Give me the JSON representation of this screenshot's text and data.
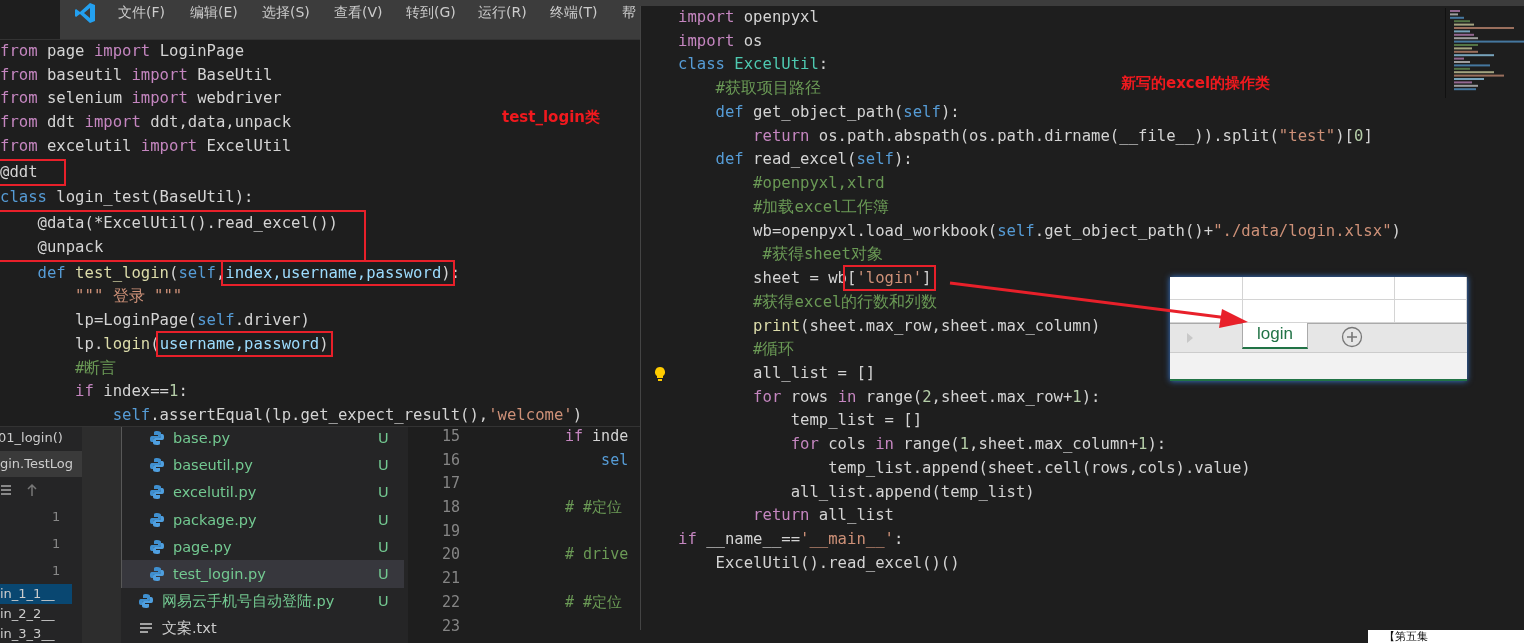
{
  "background_editor": {
    "menu": [
      "文件(F)",
      "编辑(E)",
      "选择(S)",
      "查看(V)",
      "转到(G)",
      "运行(R)",
      "终端(T)",
      "帮"
    ],
    "test_panel": {
      "items": [
        {
          "label": "01_login()",
          "kind": "method"
        },
        {
          "label": "gin.TestLog",
          "kind": "header"
        }
      ],
      "counts": [
        "1",
        "1",
        "1"
      ],
      "runs": [
        {
          "label": "in_1_1__",
          "selected": true
        },
        {
          "label": "in_2_2__",
          "selected": false
        },
        {
          "label": "in_3_3__",
          "selected": false
        }
      ]
    },
    "explorer": {
      "folder_files": [
        {
          "name": "base.py",
          "status": "U",
          "selected": false
        },
        {
          "name": "baseutil.py",
          "status": "U",
          "selected": false
        },
        {
          "name": "excelutil.py",
          "status": "U",
          "selected": false
        },
        {
          "name": "package.py",
          "status": "U",
          "selected": false
        },
        {
          "name": "page.py",
          "status": "U",
          "selected": false
        },
        {
          "name": "test_login.py",
          "status": "U",
          "selected": true
        }
      ],
      "files": [
        {
          "name": "网易云手机号自动登陆.py",
          "kind": "python",
          "status": "U",
          "selected": false
        },
        {
          "name": "文案.txt",
          "kind": "text",
          "selected": false
        }
      ]
    },
    "editor": {
      "lines": [
        {
          "number": "15",
          "tokens": [
            {
              "kind": "keyword",
              "text": "if"
            },
            {
              "kind": "plain",
              "text": " inde"
            }
          ]
        },
        {
          "number": "16",
          "tokens": [
            {
              "kind": "storage",
              "text": "    sel"
            }
          ]
        },
        {
          "number": "17"
        },
        {
          "number": "18",
          "tokens": [
            {
              "kind": "comment",
              "text": "# #定位"
            }
          ]
        },
        {
          "number": "19"
        },
        {
          "number": "20",
          "tokens": [
            {
              "kind": "comment",
              "text": "# drive"
            }
          ]
        },
        {
          "number": "21"
        },
        {
          "number": "22",
          "tokens": [
            {
              "kind": "comment",
              "text": "# #定位"
            }
          ]
        },
        {
          "number": "23"
        }
      ]
    }
  },
  "left_code": {
    "annotation": "test_login类",
    "lines": [
      {
        "tokens": [
          {
            "kind": "keyword",
            "text": "from"
          },
          {
            "kind": "plain",
            "text": " page "
          },
          {
            "kind": "keyword",
            "text": "import"
          },
          {
            "kind": "plain",
            "text": " LoginPage"
          }
        ]
      },
      {
        "tokens": [
          {
            "kind": "keyword",
            "text": "from"
          },
          {
            "kind": "plain",
            "text": " baseutil "
          },
          {
            "kind": "keyword",
            "text": "import"
          },
          {
            "kind": "plain",
            "text": " BaseUtil"
          }
        ]
      },
      {
        "tokens": [
          {
            "kind": "keyword",
            "text": "from"
          },
          {
            "kind": "plain",
            "text": " selenium "
          },
          {
            "kind": "keyword",
            "text": "import"
          },
          {
            "kind": "plain",
            "text": " webdriver"
          }
        ]
      },
      {
        "tokens": [
          {
            "kind": "keyword",
            "text": "from"
          },
          {
            "kind": "plain",
            "text": " ddt "
          },
          {
            "kind": "keyword",
            "text": "import"
          },
          {
            "kind": "plain",
            "text": " ddt,data,unpack"
          }
        ]
      },
      {
        "tokens": [
          {
            "kind": "keyword",
            "text": "from"
          },
          {
            "kind": "plain",
            "text": " excelutil "
          },
          {
            "kind": "keyword",
            "text": "import"
          },
          {
            "kind": "plain",
            "text": " ExcelUtil"
          }
        ]
      },
      {
        "boxed": true,
        "tokens": [
          {
            "kind": "plain",
            "text": "@ddt"
          }
        ]
      },
      {
        "tokens": [
          {
            "kind": "storage",
            "text": "class"
          },
          {
            "kind": "plain",
            "text": " login_test(BaseUtil):"
          }
        ]
      },
      {
        "boxed": true,
        "tokens": [
          {
            "kind": "plain",
            "text": "    @data(*ExcelUtil().read_excel())"
          }
        ]
      },
      {
        "boxed": true,
        "tokens": [
          {
            "kind": "plain",
            "text": "    @unpack"
          }
        ]
      },
      {
        "tokens": [
          {
            "kind": "storage",
            "text": "    def "
          },
          {
            "kind": "function",
            "text": "test_login"
          },
          {
            "kind": "plain",
            "text": "("
          },
          {
            "kind": "storage",
            "text": "self"
          },
          {
            "kind": "plain",
            "text": ","
          },
          {
            "kind": "variable",
            "text": "index,username,password",
            "boxed": true
          },
          {
            "kind": "plain",
            "text": ")",
            "boxed": true
          },
          {
            "kind": "plain",
            "text": ":"
          }
        ]
      },
      {
        "tokens": [
          {
            "kind": "string",
            "text": "        \"\"\" 登录 \"\"\""
          }
        ]
      },
      {
        "tokens": [
          {
            "kind": "plain",
            "text": "        lp=LoginPage("
          },
          {
            "kind": "storage",
            "text": "self"
          },
          {
            "kind": "plain",
            "text": ".driver)"
          }
        ]
      },
      {
        "tokens": [
          {
            "kind": "plain",
            "text": "        lp."
          },
          {
            "kind": "function",
            "text": "login"
          },
          {
            "kind": "plain",
            "text": "("
          },
          {
            "kind": "variable",
            "text": "username,password",
            "boxed": true
          },
          {
            "kind": "plain",
            "text": ")",
            "boxed": true
          }
        ]
      },
      {
        "tokens": [
          {
            "kind": "comment",
            "text": "        #断言"
          }
        ]
      },
      {
        "tokens": [
          {
            "kind": "keyword",
            "text": "        if"
          },
          {
            "kind": "plain",
            "text": " index=="
          },
          {
            "kind": "number",
            "text": "1"
          },
          {
            "kind": "plain",
            "text": ":"
          }
        ]
      },
      {
        "tokens": [
          {
            "kind": "storage",
            "text": "            self"
          },
          {
            "kind": "plain",
            "text": ".assertEqual(lp.get_expect_result(),"
          },
          {
            "kind": "string",
            "text": "'welcome'"
          },
          {
            "kind": "plain",
            "text": ")"
          }
        ]
      }
    ]
  },
  "right_code": {
    "annotation": "新写的excel的操作类",
    "lines": [
      {
        "tokens": [
          {
            "kind": "keyword",
            "text": "import"
          },
          {
            "kind": "plain",
            "text": " openpyxl"
          }
        ]
      },
      {
        "tokens": [
          {
            "kind": "keyword",
            "text": "import"
          },
          {
            "kind": "plain",
            "text": " os"
          }
        ]
      },
      {
        "tokens": [
          {
            "kind": "storage",
            "text": "class "
          },
          {
            "kind": "type",
            "text": "ExcelUtil"
          },
          {
            "kind": "plain",
            "text": ":"
          }
        ]
      },
      {
        "tokens": [
          {
            "kind": "comment",
            "text": "    #获取项目路径"
          }
        ]
      },
      {
        "tokens": [
          {
            "kind": "storage",
            "text": "    def"
          },
          {
            "kind": "plain",
            "text": " get_object_path("
          },
          {
            "kind": "storage",
            "text": "self"
          },
          {
            "kind": "plain",
            "text": "):"
          }
        ]
      },
      {
        "tokens": [
          {
            "kind": "keyword",
            "text": "        return"
          },
          {
            "kind": "plain",
            "text": " os.path.abspath(os.path.dirname(__file__)).split("
          },
          {
            "kind": "string",
            "text": "\"test\""
          },
          {
            "kind": "plain",
            "text": ")["
          },
          {
            "kind": "number",
            "text": "0"
          },
          {
            "kind": "plain",
            "text": "]"
          }
        ]
      },
      {
        "tokens": [
          {
            "kind": "storage",
            "text": "    def"
          },
          {
            "kind": "plain",
            "text": " read_excel("
          },
          {
            "kind": "storage",
            "text": "self"
          },
          {
            "kind": "plain",
            "text": "):"
          }
        ]
      },
      {
        "tokens": [
          {
            "kind": "comment",
            "text": "        #openpyxl,xlrd"
          }
        ]
      },
      {
        "tokens": [
          {
            "kind": "comment",
            "text": "        #加载excel工作簿"
          }
        ]
      },
      {
        "tokens": [
          {
            "kind": "plain",
            "text": "        wb=openpyxl.load_workbook("
          },
          {
            "kind": "storage",
            "text": "self"
          },
          {
            "kind": "plain",
            "text": ".get_object_path()+"
          },
          {
            "kind": "string",
            "text": "\"./data/login.xlsx\""
          },
          {
            "kind": "plain",
            "text": ")"
          }
        ]
      },
      {
        "tokens": [
          {
            "kind": "comment",
            "text": "         #获得sheet对象"
          }
        ]
      },
      {
        "tokens": [
          {
            "kind": "plain",
            "text": "        sheet = wb"
          },
          {
            "kind": "plain",
            "text": "[",
            "boxed": true
          },
          {
            "kind": "string",
            "text": "'login'",
            "boxed": true
          },
          {
            "kind": "plain",
            "text": "]",
            "boxed": true
          }
        ]
      },
      {
        "tokens": [
          {
            "kind": "comment",
            "text": "        #获得excel的行数和列数"
          }
        ]
      },
      {
        "tokens": [
          {
            "kind": "function",
            "text": "        print"
          },
          {
            "kind": "plain",
            "text": "(sheet.max_row,sheet.max_column)"
          }
        ]
      },
      {
        "tokens": [
          {
            "kind": "comment",
            "text": "        #循环"
          }
        ]
      },
      {
        "lightbulb": true,
        "tokens": [
          {
            "kind": "plain",
            "text": "        all_list = []"
          }
        ]
      },
      {
        "tokens": [
          {
            "kind": "keyword",
            "text": "        for"
          },
          {
            "kind": "plain",
            "text": " rows "
          },
          {
            "kind": "keyword",
            "text": "in"
          },
          {
            "kind": "plain",
            "text": " range("
          },
          {
            "kind": "number",
            "text": "2"
          },
          {
            "kind": "plain",
            "text": ",sheet.max_row+"
          },
          {
            "kind": "number",
            "text": "1"
          },
          {
            "kind": "plain",
            "text": "):"
          }
        ]
      },
      {
        "tokens": [
          {
            "kind": "plain",
            "text": "            temp_list = []"
          }
        ]
      },
      {
        "tokens": [
          {
            "kind": "keyword",
            "text": "            for"
          },
          {
            "kind": "plain",
            "text": " cols "
          },
          {
            "kind": "keyword",
            "text": "in"
          },
          {
            "kind": "plain",
            "text": " range("
          },
          {
            "kind": "number",
            "text": "1"
          },
          {
            "kind": "plain",
            "text": ",sheet.max_column+"
          },
          {
            "kind": "number",
            "text": "1"
          },
          {
            "kind": "plain",
            "text": "):"
          }
        ]
      },
      {
        "tokens": [
          {
            "kind": "plain",
            "text": "                temp_list.append(sheet.cell(rows,cols).value)"
          }
        ]
      },
      {
        "tokens": [
          {
            "kind": "plain",
            "text": "            all_list.append(temp_list)"
          }
        ]
      },
      {
        "tokens": [
          {
            "kind": "keyword",
            "text": "        return"
          },
          {
            "kind": "plain",
            "text": " all_list"
          }
        ]
      },
      {
        "tokens": [
          {
            "kind": "keyword",
            "text": "if"
          },
          {
            "kind": "plain",
            "text": " __name__=="
          },
          {
            "kind": "string",
            "text": "'__main__'"
          },
          {
            "kind": "plain",
            "text": ":"
          }
        ]
      },
      {
        "tokens": [
          {
            "kind": "plain",
            "text": "    ExcelUtil().read_excel()()"
          }
        ]
      }
    ]
  },
  "sheet_tabs": [
    {
      "label": "login",
      "selected": true
    }
  ],
  "corner_caption": "【第五集"
}
